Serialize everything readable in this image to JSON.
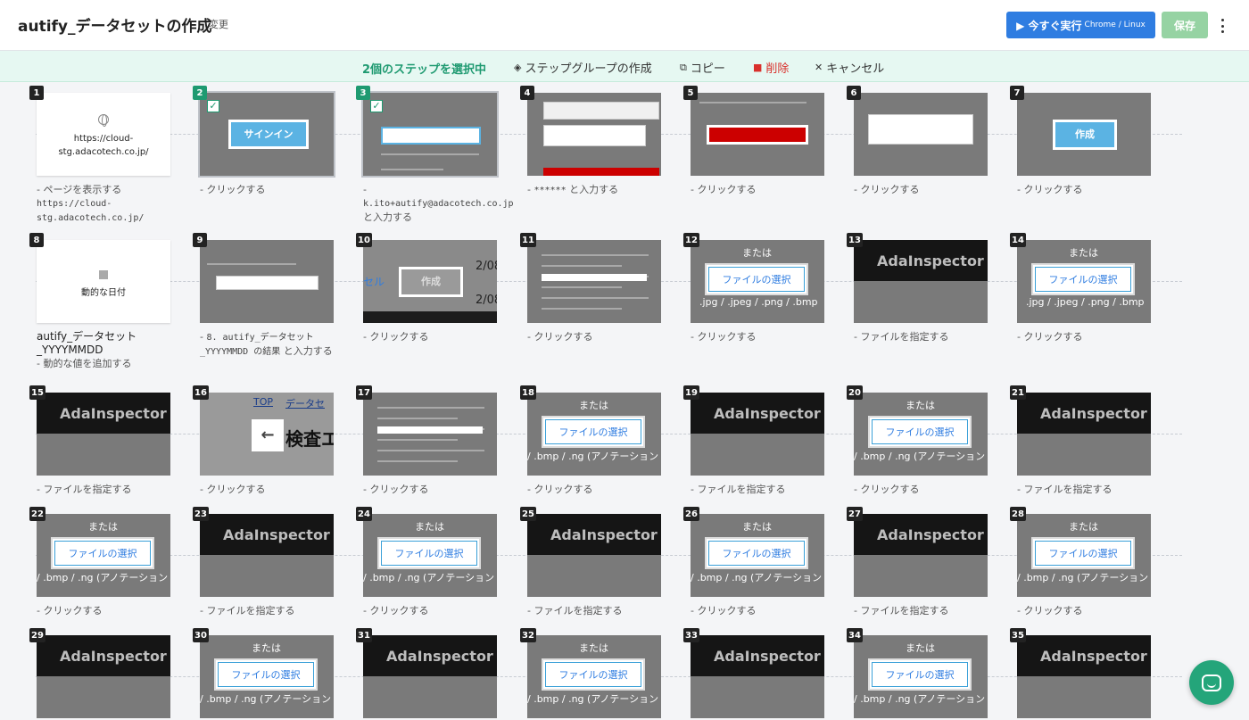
{
  "header": {
    "title": "autify_データセットの作成",
    "edit_label": "変更",
    "run_label": "▶ 今すぐ実行",
    "run_sub": "Chrome / Linux",
    "save_label": "保存"
  },
  "selection_bar": {
    "count_label": "2個のステップを選択中",
    "group_label": "ステップグループの作成",
    "copy_label": "コピー",
    "delete_label": "削除",
    "cancel_label": "キャンセル"
  },
  "thumb_text": {
    "url": "https://cloud-stg.adacotech.co.jp/",
    "signin": "サインイン",
    "create": "作成",
    "dynamic_date": "動的な日付",
    "file_select": "ファイルの選択",
    "adainspector": "AdaInspector Cl",
    "or": "または",
    "ext1": ".jpg / .jpeg / .png / .bmp",
    "ext2": "/ .bmp / .ng (アノテーション",
    "top": "TOP",
    "dataset": "データセ",
    "kensa": "検査エ",
    "cancel_partial": "セル",
    "date_partial": "2/08"
  },
  "steps": [
    {
      "num": "1",
      "type": "url",
      "label_pre": "- ページを表示する ",
      "label_code": "https://cloud-stg.adacotech.co.jp/",
      "label_post": ""
    },
    {
      "num": "2",
      "type": "signin",
      "selected": true,
      "label_pre": "- クリックする",
      "label_code": "",
      "label_post": ""
    },
    {
      "num": "3",
      "type": "form",
      "selected": true,
      "label_pre": "- ",
      "label_code": "k.ito+autify@adacotech.co.jp",
      "label_post": " と入力する"
    },
    {
      "num": "4",
      "type": "form2",
      "label_pre": "- ",
      "label_code": "******",
      "label_post": " と入力する"
    },
    {
      "num": "5",
      "type": "redbtn",
      "label_pre": "- クリックする",
      "label_code": "",
      "label_post": ""
    },
    {
      "num": "6",
      "type": "dataset",
      "label_pre": "- クリックする",
      "label_code": "",
      "label_post": ""
    },
    {
      "num": "7",
      "type": "create",
      "label_pre": "- クリックする",
      "label_code": "",
      "label_post": ""
    },
    {
      "num": "8",
      "type": "dynamic",
      "label_name": "autify_データセット_YYYYMMDD",
      "label_pre": "- 動的な値を追加する",
      "label_code": "",
      "label_post": ""
    },
    {
      "num": "9",
      "type": "dialog",
      "label_pre": "- ",
      "label_code": "8. autify_データセット_YYYYMMDD の結果",
      "label_post": " と入力する"
    },
    {
      "num": "10",
      "type": "create2",
      "label_pre": "- クリックする",
      "label_code": "",
      "label_post": ""
    },
    {
      "num": "11",
      "type": "list",
      "label_pre": "- クリックする",
      "label_code": "",
      "label_post": ""
    },
    {
      "num": "12",
      "type": "file1",
      "label_pre": "- クリックする",
      "label_code": "",
      "label_post": ""
    },
    {
      "num": "13",
      "type": "ada",
      "label_pre": "- ファイルを指定する",
      "label_code": "",
      "label_post": ""
    },
    {
      "num": "14",
      "type": "file1",
      "label_pre": "- クリックする",
      "label_code": "",
      "label_post": ""
    },
    {
      "num": "15",
      "type": "ada",
      "label_pre": "- ファイルを指定する",
      "label_code": "",
      "label_post": ""
    },
    {
      "num": "16",
      "type": "back",
      "label_pre": "- クリックする",
      "label_code": "",
      "label_post": ""
    },
    {
      "num": "17",
      "type": "list",
      "label_pre": "- クリックする",
      "label_code": "",
      "label_post": ""
    },
    {
      "num": "18",
      "type": "file2",
      "label_pre": "- クリックする",
      "label_code": "",
      "label_post": ""
    },
    {
      "num": "19",
      "type": "ada",
      "label_pre": "- ファイルを指定する",
      "label_code": "",
      "label_post": ""
    },
    {
      "num": "20",
      "type": "file2",
      "label_pre": "- クリックする",
      "label_code": "",
      "label_post": ""
    },
    {
      "num": "21",
      "type": "ada",
      "label_pre": "- ファイルを指定する",
      "label_code": "",
      "label_post": ""
    },
    {
      "num": "22",
      "type": "file2",
      "label_pre": "- クリックする",
      "label_code": "",
      "label_post": ""
    },
    {
      "num": "23",
      "type": "ada",
      "label_pre": "- ファイルを指定する",
      "label_code": "",
      "label_post": ""
    },
    {
      "num": "24",
      "type": "file2",
      "label_pre": "- クリックする",
      "label_code": "",
      "label_post": ""
    },
    {
      "num": "25",
      "type": "ada",
      "label_pre": "- ファイルを指定する",
      "label_code": "",
      "label_post": ""
    },
    {
      "num": "26",
      "type": "file2",
      "label_pre": "- クリックする",
      "label_code": "",
      "label_post": ""
    },
    {
      "num": "27",
      "type": "ada",
      "label_pre": "- ファイルを指定する",
      "label_code": "",
      "label_post": ""
    },
    {
      "num": "28",
      "type": "file2",
      "label_pre": "- クリックする",
      "label_code": "",
      "label_post": ""
    },
    {
      "num": "29",
      "type": "ada",
      "label_pre": "",
      "label_code": "",
      "label_post": ""
    },
    {
      "num": "30",
      "type": "file2",
      "label_pre": "",
      "label_code": "",
      "label_post": ""
    },
    {
      "num": "31",
      "type": "ada",
      "label_pre": "",
      "label_code": "",
      "label_post": ""
    },
    {
      "num": "32",
      "type": "file2",
      "label_pre": "",
      "label_code": "",
      "label_post": ""
    },
    {
      "num": "33",
      "type": "ada",
      "label_pre": "",
      "label_code": "",
      "label_post": ""
    },
    {
      "num": "34",
      "type": "file2",
      "label_pre": "",
      "label_code": "",
      "label_post": ""
    },
    {
      "num": "35",
      "type": "ada",
      "label_pre": "",
      "label_code": "",
      "label_post": ""
    }
  ],
  "icons": {
    "run": "play-icon",
    "group": "layers-icon",
    "copy": "copy-icon",
    "delete": "trash-icon",
    "cancel": "close-icon",
    "chat": "chat-icon"
  }
}
